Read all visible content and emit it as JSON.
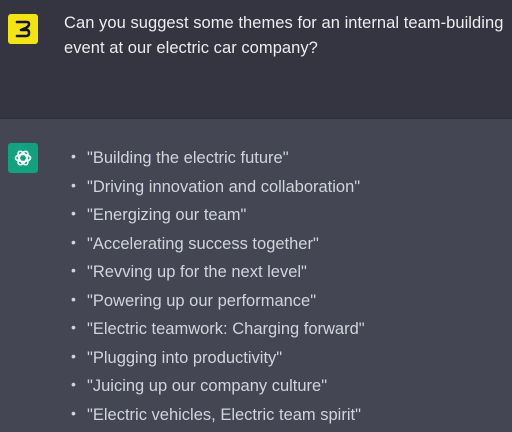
{
  "user": {
    "avatar_icon": "user-logo-icon",
    "message": "Can you suggest some themes for an internal team-building event at our electric car company?"
  },
  "assistant": {
    "avatar_icon": "openai-logo-icon",
    "bullet": "•",
    "items": [
      "\"Building the electric future\"",
      "\"Driving innovation and collaboration\"",
      "\"Energizing our team\"",
      "\"Accelerating success together\"",
      "\"Revving up for the next level\"",
      "\"Powering up our performance\"",
      "\"Electric teamwork: Charging forward\"",
      "\"Plugging into productivity\"",
      "\"Juicing up our company culture\"",
      "\"Electric vehicles, Electric team spirit\""
    ]
  },
  "colors": {
    "user_bg": "#343541",
    "assistant_bg": "#444654",
    "user_avatar_bg": "#f5e50f",
    "assistant_avatar_bg": "#10a37f",
    "text": "#ececf1"
  }
}
